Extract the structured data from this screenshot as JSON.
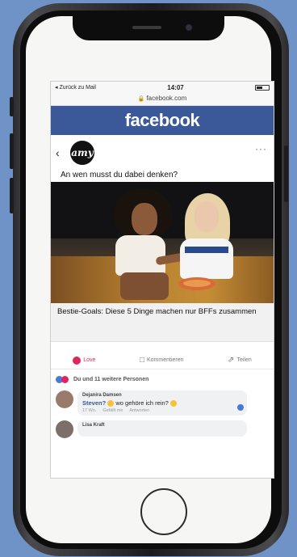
{
  "statusbar": {
    "back_label": "◂ Zurück zu Mail",
    "time": "14:07"
  },
  "browser": {
    "url": "facebook.com"
  },
  "facebook": {
    "logo": "facebook"
  },
  "post": {
    "avatar_text": "amy",
    "question": "An wen musst du dabei denken?",
    "link_title": "Bestie-Goals: Diese 5 Dinge machen nur BFFs zusammen",
    "actions": {
      "love": "Love",
      "comment": "Kommentieren",
      "share": "Teilen"
    },
    "reactions_text": "Du und 11 weitere Personen"
  },
  "comments": [
    {
      "author": "Dejanira Damsen",
      "mention": "Steven?",
      "text": "wo gehöre ich rein?",
      "meta_time": "17 Wo.",
      "meta_like": "Gefällt mir",
      "meta_reply": "Antworten"
    },
    {
      "author": "Lisa Kraft"
    }
  ],
  "colors": {
    "facebook_blue": "#3b5998",
    "love_red": "#e0245e",
    "background": "#6f93c6"
  }
}
